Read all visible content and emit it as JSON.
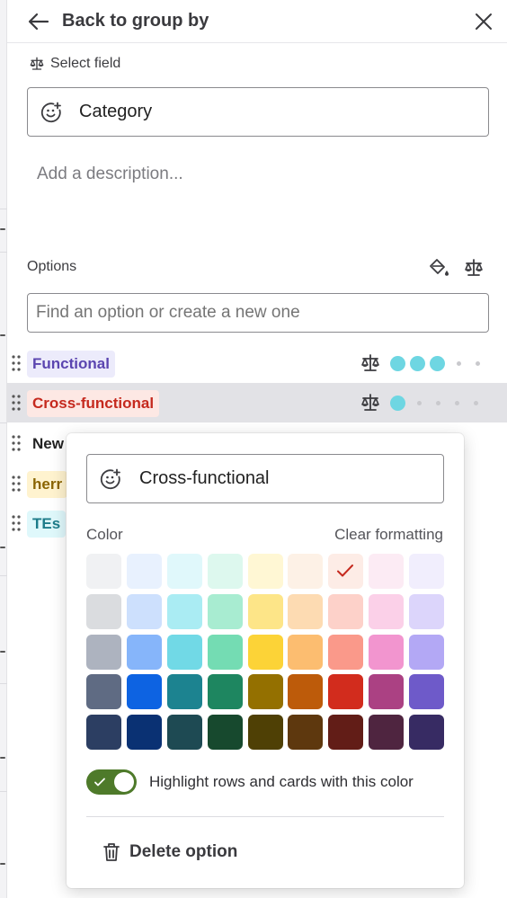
{
  "header": {
    "back_label": "Back to group by",
    "back_icon": "arrow-left-icon",
    "close_icon": "close-icon"
  },
  "field": {
    "select_label": "Select field",
    "name_value": "Category",
    "description_placeholder": "Add a description..."
  },
  "options": {
    "label": "Options",
    "search_placeholder": "Find an option or create a new one",
    "items": [
      {
        "label": "Functional",
        "fg": "#5b45b0",
        "bg": "#ecebfb",
        "selected": false,
        "big_dots": 3,
        "small_dots": 2,
        "show_meta": true
      },
      {
        "label": "Cross-functional",
        "fg": "#c5291e",
        "bg": "#fde8e4",
        "selected": true,
        "big_dots": 1,
        "small_dots": 4,
        "show_meta": true
      },
      {
        "label": "New",
        "fg": "#222222",
        "bg": "transparent",
        "selected": false,
        "big_dots": 0,
        "small_dots": 1,
        "show_meta": false
      },
      {
        "label": "herr",
        "fg": "#8a6400",
        "bg": "#fff3cf",
        "selected": false,
        "big_dots": 0,
        "small_dots": 1,
        "show_meta": false
      },
      {
        "label": "TEs",
        "fg": "#1d7c8a",
        "bg": "#dff8fb",
        "selected": false,
        "big_dots": 0,
        "small_dots": 1,
        "show_meta": false
      }
    ]
  },
  "popover": {
    "option_name": "Cross-functional",
    "color_label": "Color",
    "clear_label": "Clear formatting",
    "selected_color": "#fdece6",
    "colors": [
      [
        "#f0f1f3",
        "#e8f1fe",
        "#e0f8fb",
        "#ddf8ee",
        "#fff7d4",
        "#fdf1e6",
        "#fdece6",
        "#fcebf4",
        "#f1eefd"
      ],
      [
        "#dadcdf",
        "#cde0fd",
        "#aaecf3",
        "#a8ecd1",
        "#fde588",
        "#fddbb2",
        "#fdd1c9",
        "#fbd0e8",
        "#dcd5fb"
      ],
      [
        "#adb3bf",
        "#86b5fa",
        "#71d9e6",
        "#74dcb3",
        "#fcd337",
        "#fcbd70",
        "#fa998a",
        "#f295cf",
        "#b3a8f5"
      ],
      [
        "#5f6b83",
        "#0d63e2",
        "#1c8390",
        "#1e8660",
        "#947000",
        "#bd5b0a",
        "#d22c1d",
        "#ab4183",
        "#6e5ac9"
      ],
      [
        "#2c3e62",
        "#0a3173",
        "#1e4a53",
        "#17492e",
        "#4f4005",
        "#5e380e",
        "#621d17",
        "#4f2540",
        "#372b63"
      ]
    ],
    "highlight_label": "Highlight rows and cards with this color",
    "highlight_on": true,
    "delete_label": "Delete option"
  },
  "icons": {
    "balance": "balance-scale-icon",
    "emoji": "emoji-add-icon",
    "paint": "paint-bucket-icon",
    "drag": "drag-handle-icon",
    "trash": "trash-icon",
    "check": "check-icon"
  }
}
